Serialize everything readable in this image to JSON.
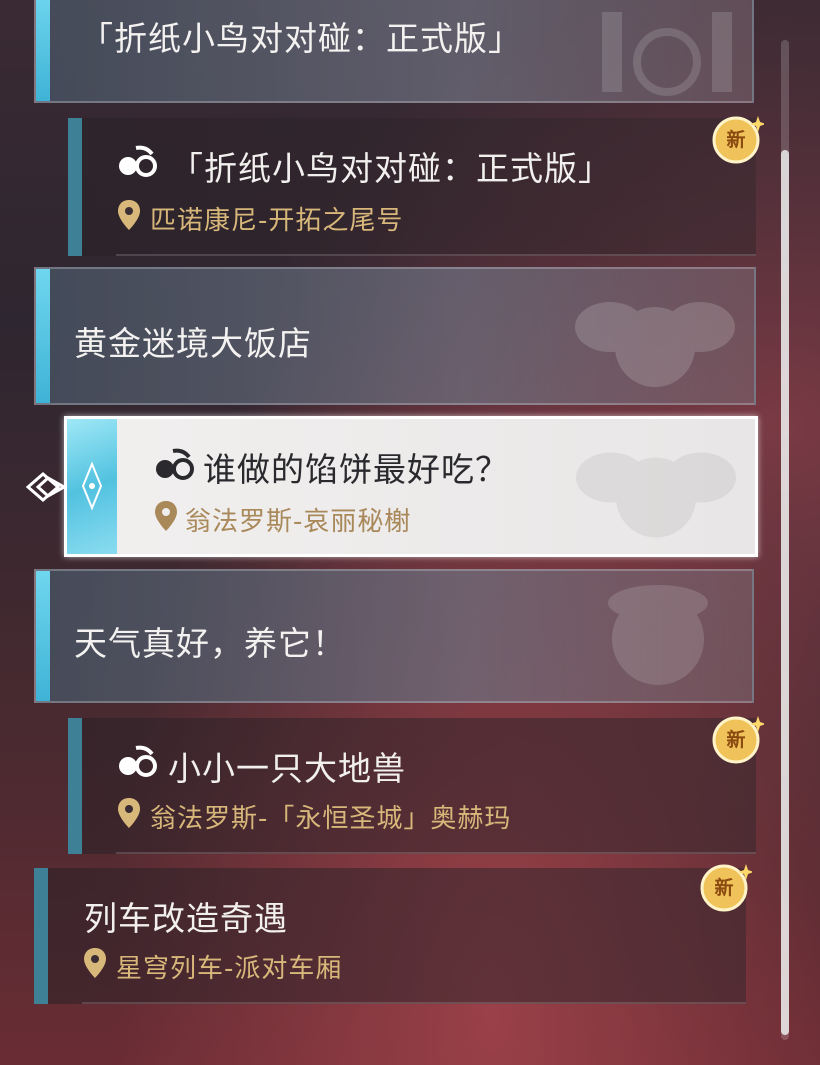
{
  "groups": [
    {
      "title": "「折纸小鸟对对碰：正式版」"
    },
    {
      "title": "黄金迷境大饭店"
    },
    {
      "title": "天气真好，养它！"
    }
  ],
  "quests": [
    {
      "title": "「折纸小鸟对对碰：正式版」",
      "location": "匹诺康尼-开拓之尾号",
      "badge": "新"
    },
    {
      "title": "谁做的馅饼最好吃？",
      "location": "翁法罗斯-哀丽秘榭"
    },
    {
      "title": "小小一只大地兽",
      "location": "翁法罗斯-「永恒圣城」奥赫玛",
      "badge": "新"
    },
    {
      "title": "列车改造奇遇",
      "location": "星穹列车-派对车厢",
      "badge": "新"
    }
  ],
  "icons": {
    "quest": "companion-quest-icon",
    "location": "location-pin-icon",
    "new_badge": "new-badge-icon",
    "selected_pointer": "diamond-pointer-icon"
  },
  "colors": {
    "accent_cyan": "#6fd6ee",
    "location_gold": "#d8b77a",
    "badge_gold": "#e8b84a"
  }
}
